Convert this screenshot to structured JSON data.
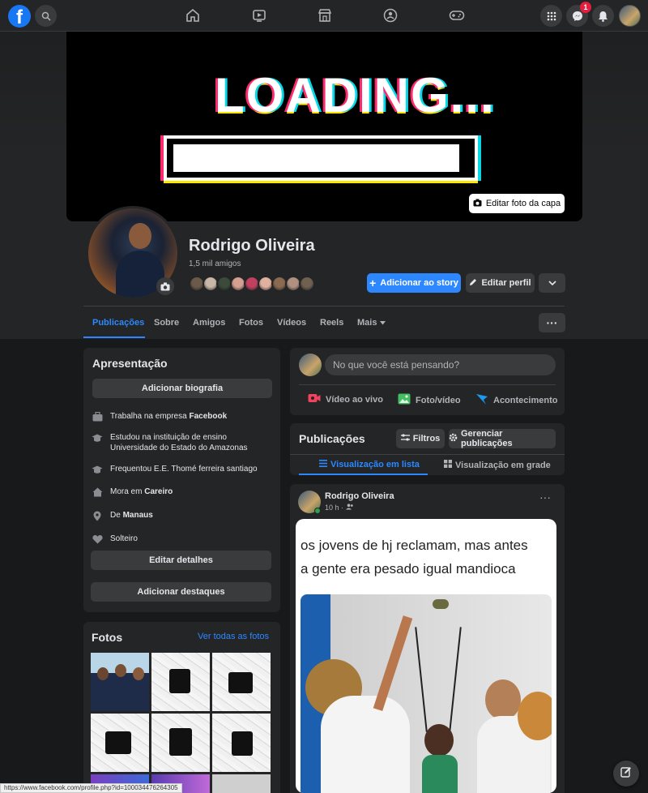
{
  "topbar": {
    "logo": "f",
    "icons": [
      "search-icon",
      "home-icon",
      "watch-icon",
      "marketplace-icon",
      "groups-icon",
      "gaming-icon",
      "menu-grid-icon",
      "messenger-icon",
      "notifications-icon"
    ],
    "messenger_badge": "1"
  },
  "cover": {
    "image_text": "LOADING...",
    "loading_progress": 0.97,
    "edit_button": "Editar foto da capa"
  },
  "profile": {
    "name": "Rodrigo Oliveira",
    "friends_count": "1,5 mil amigos",
    "add_story": "Adicionar ao story",
    "edit_profile": "Editar perfil",
    "friend_avatar_colors": [
      "#6b5a4a",
      "#c9b8a8",
      "#3b4a3a",
      "#d4a090",
      "#c04060",
      "#e0b0a0",
      "#8a6a50",
      "#b09080",
      "#706050"
    ]
  },
  "tabs": [
    {
      "label": "Publicações",
      "active": true
    },
    {
      "label": "Sobre"
    },
    {
      "label": "Amigos"
    },
    {
      "label": "Fotos"
    },
    {
      "label": "Vídeos"
    },
    {
      "label": "Reels"
    },
    {
      "label": "Mais"
    }
  ],
  "intro": {
    "title": "Apresentação",
    "add_bio": "Adicionar biografia",
    "rows": [
      {
        "icon": "briefcase-icon",
        "text": "Trabalha na empresa ",
        "bold": "Facebook"
      },
      {
        "icon": "graduation-cap-icon",
        "text": "Estudou na instituição de ensino",
        "text2": "Universidade do Estado do Amazonas"
      },
      {
        "icon": "graduation-cap-icon",
        "text": "Frequentou E.E. Thomé ferreira santiago"
      },
      {
        "icon": "home-icon",
        "text": "Mora em ",
        "bold": "Careiro"
      },
      {
        "icon": "location-pin-icon",
        "text": "De ",
        "bold": "Manaus"
      },
      {
        "icon": "heart-icon",
        "text": "Solteiro"
      }
    ],
    "edit_details": "Editar detalhes",
    "add_highlights": "Adicionar destaques"
  },
  "photos": {
    "title": "Fotos",
    "see_all": "Ver todas as fotos"
  },
  "composer": {
    "placeholder": "No que você está pensando?",
    "live_video": "Vídeo ao vivo",
    "photo_video": "Foto/vídeo",
    "life_event": "Acontecimento"
  },
  "posts_header": {
    "title": "Publicações",
    "filters": "Filtros",
    "manage": "Gerenciar publicações",
    "list_view": "Visualização em lista",
    "grid_view": "Visualização em grade"
  },
  "post": {
    "author": "Rodrigo Oliveira",
    "time": "10 h ·",
    "meme_line1": "os jovens de hj reclamam, mas antes",
    "meme_line2": "a gente era pesado igual mandioca"
  },
  "status_url": "https://www.facebook.com/profile.php?id=100034476264305",
  "colors": {
    "accent": "#2d88ff",
    "background": "#18191a",
    "card": "#242526",
    "button": "#3a3b3c"
  }
}
